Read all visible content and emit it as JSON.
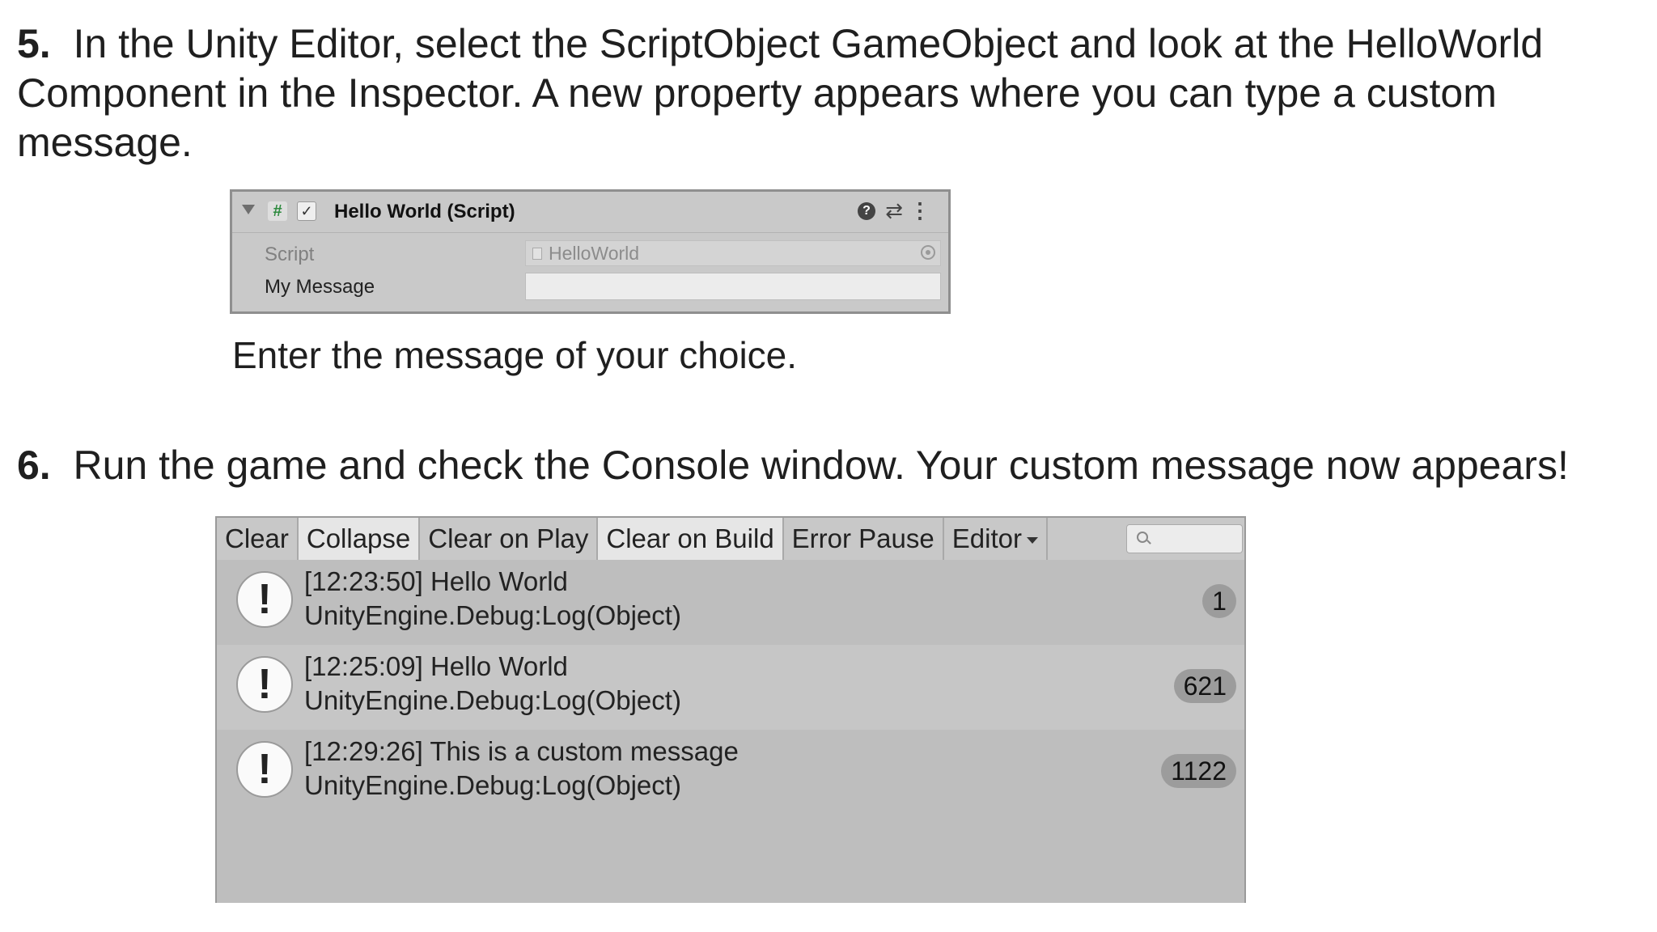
{
  "step5": {
    "number": "5.",
    "text": "In the Unity Editor, select the ScriptObject GameObject and look at the HelloWorld Component in the Inspector. A new property appears where you can type a custom message."
  },
  "inspector": {
    "component_title": "Hello World (Script)",
    "hash_glyph": "#",
    "checkmark": "✓",
    "help_glyph": "?",
    "preset_glyph": "⇄",
    "more_glyph": "⋮",
    "script_label": "Script",
    "script_value": "HelloWorld",
    "message_label": "My Message",
    "message_value": "",
    "icons": [
      "foldout-arrow-icon",
      "script-hash-icon",
      "checkbox-icon",
      "help-icon",
      "presets-icon",
      "more-menu-icon",
      "object-picker-icon"
    ]
  },
  "caption": "Enter the message of your choice.",
  "step6": {
    "number": "6.",
    "text": "Run the game and check the Console window. Your custom message now appears!"
  },
  "console": {
    "toolbar": {
      "clear": "Clear",
      "collapse": "Collapse",
      "clear_on_play": "Clear on Play",
      "clear_on_build": "Clear on Build",
      "error_pause": "Error Pause",
      "editor": "Editor"
    },
    "entries": [
      {
        "line1": "[12:23:50] Hello World",
        "line2": "UnityEngine.Debug:Log(Object)",
        "count": "1",
        "icon_glyph": "!"
      },
      {
        "line1": "[12:25:09] Hello World",
        "line2": "UnityEngine.Debug:Log(Object)",
        "count": "621",
        "icon_glyph": "!"
      },
      {
        "line1": "[12:29:26] This is a custom message",
        "line2": "UnityEngine.Debug:Log(Object)",
        "count": "1122",
        "icon_glyph": "!"
      }
    ]
  }
}
